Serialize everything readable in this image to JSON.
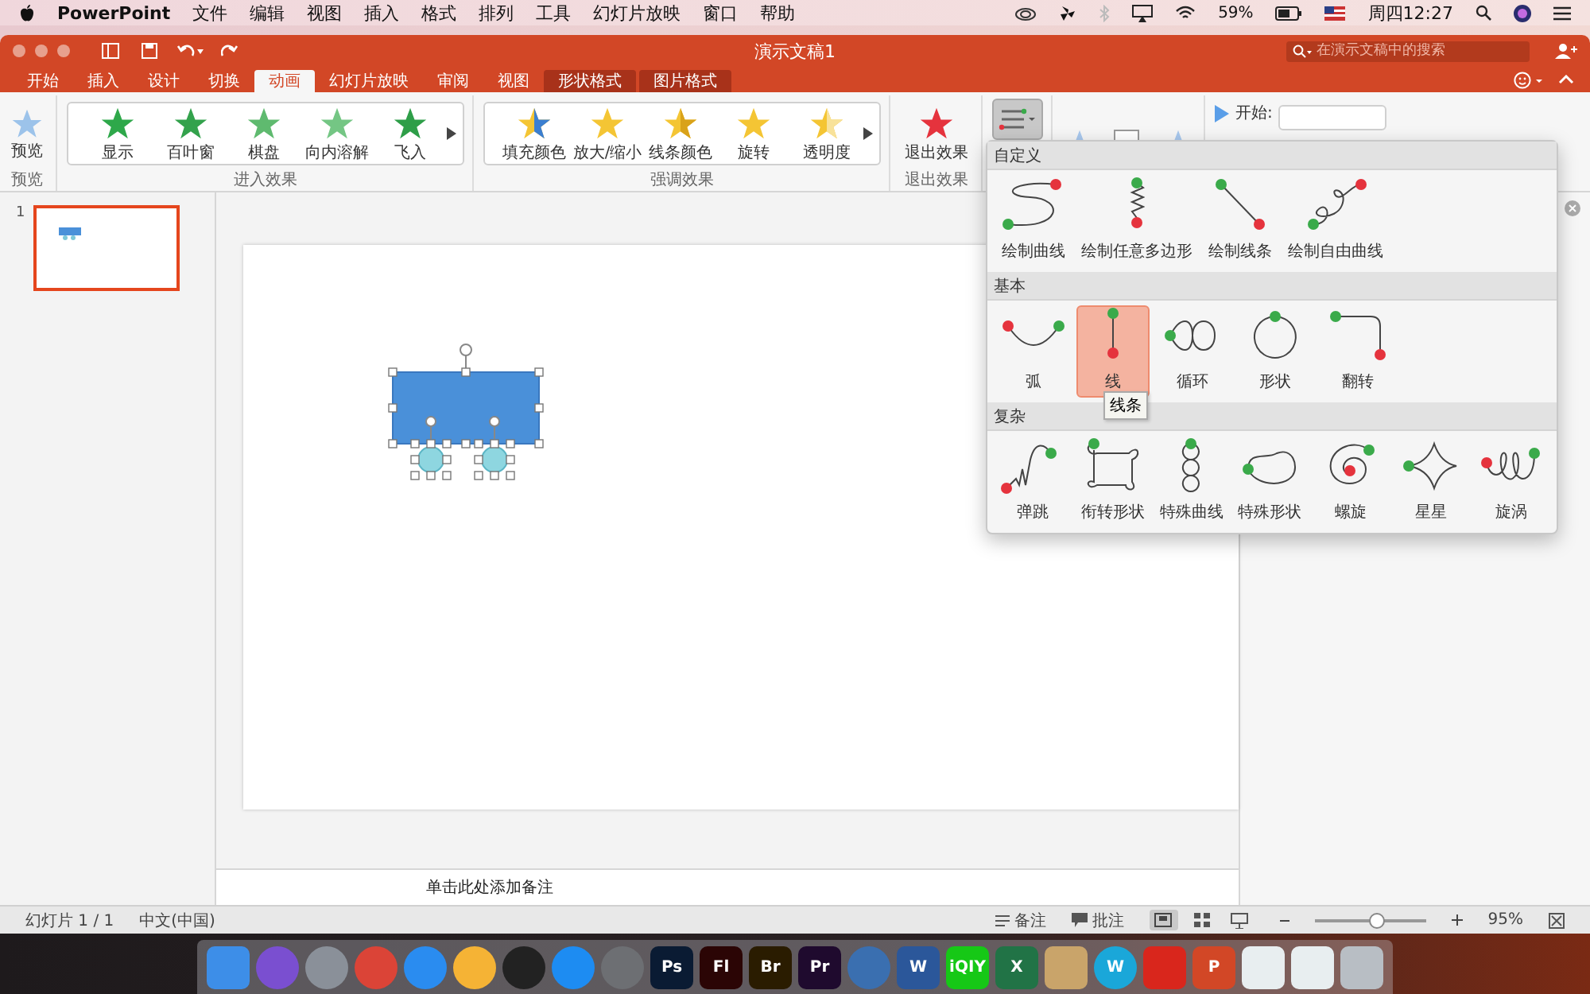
{
  "menu_bar": {
    "app": "PowerPoint",
    "items": [
      "文件",
      "编辑",
      "视图",
      "插入",
      "格式",
      "排列",
      "工具",
      "幻灯片放映",
      "窗口",
      "帮助"
    ],
    "battery": "59%",
    "clock": "周四12:27"
  },
  "window": {
    "title": "演示文稿1",
    "search": {
      "placeholder": "在演示文稿中的搜索"
    }
  },
  "tabs": [
    {
      "label": "开始",
      "selected": false,
      "kind": "normal"
    },
    {
      "label": "插入",
      "selected": false,
      "kind": "normal"
    },
    {
      "label": "设计",
      "selected": false,
      "kind": "normal"
    },
    {
      "label": "切换",
      "selected": false,
      "kind": "normal"
    },
    {
      "label": "动画",
      "selected": true,
      "kind": "normal"
    },
    {
      "label": "幻灯片放映",
      "selected": false,
      "kind": "normal"
    },
    {
      "label": "审阅",
      "selected": false,
      "kind": "normal"
    },
    {
      "label": "视图",
      "selected": false,
      "kind": "normal"
    },
    {
      "label": "形状格式",
      "selected": false,
      "kind": "context"
    },
    {
      "label": "图片格式",
      "selected": false,
      "kind": "context"
    }
  ],
  "ribbon": {
    "preview": {
      "button": "预览",
      "group": "预览"
    },
    "entrance": {
      "group": "进入效果",
      "items": [
        "显示",
        "百叶窗",
        "棋盘",
        "向内溶解",
        "飞入"
      ]
    },
    "emphasis": {
      "group": "强调效果",
      "items": [
        "填充颜色",
        "放大/缩小",
        "线条颜色",
        "旋转",
        "透明度"
      ]
    },
    "exit": {
      "button": "退出效果",
      "group": "退出效果"
    },
    "motion_paths": {
      "pressed": true
    },
    "timing": {
      "start_label": "开始:"
    }
  },
  "slides": [
    {
      "number": "1",
      "selected": true
    }
  ],
  "notes": {
    "placeholder": "单击此处添加备注"
  },
  "status_bar": {
    "slide": "幻灯片 1 / 1",
    "language": "中文(中国)",
    "notes": "备注",
    "comments": "批注",
    "views": [
      {
        "kind": "normal",
        "selected": true
      },
      {
        "kind": "sorter",
        "selected": false
      },
      {
        "kind": "presenter",
        "selected": false
      }
    ],
    "zoom": {
      "level": 0.55,
      "reading": "95%"
    }
  },
  "motion_path_menu": {
    "sections": [
      {
        "title": "自定义",
        "items": [
          {
            "label": "绘制曲线",
            "kind": "curve",
            "selected": false
          },
          {
            "label": "绘制任意多边形",
            "kind": "zigzag",
            "selected": false
          },
          {
            "label": "绘制线条",
            "kind": "line",
            "selected": false
          },
          {
            "label": "绘制自由曲线",
            "kind": "freeform",
            "selected": false
          }
        ]
      },
      {
        "title": "基本",
        "items": [
          {
            "label": "弧",
            "kind": "arc",
            "selected": false
          },
          {
            "label": "线",
            "kind": "vline",
            "selected": true
          },
          {
            "label": "循环",
            "kind": "loop",
            "selected": false
          },
          {
            "label": "形状",
            "kind": "circle",
            "selected": false
          },
          {
            "label": "翻转",
            "kind": "turn",
            "selected": false
          }
        ]
      },
      {
        "title": "复杂",
        "items": [
          {
            "label": "弹跳",
            "kind": "bounce",
            "selected": false
          },
          {
            "label": "衔转形状",
            "kind": "square",
            "selected": false
          },
          {
            "label": "特殊曲线",
            "kind": "rings",
            "selected": false
          },
          {
            "label": "特殊形状",
            "kind": "bean",
            "selected": false
          },
          {
            "label": "螺旋",
            "kind": "spiral",
            "selected": false
          },
          {
            "label": "星星",
            "kind": "star",
            "selected": false
          },
          {
            "label": "旋涡",
            "kind": "loops",
            "selected": false
          }
        ]
      }
    ],
    "tooltip": "线条"
  },
  "dock": [
    {
      "color": "#3d8ee8",
      "kind": "square"
    },
    {
      "color": "#7a4fd0",
      "kind": "round"
    },
    {
      "color": "#8a9099",
      "kind": "round"
    },
    {
      "color": "#db4437",
      "kind": "round"
    },
    {
      "color": "#2a8cf0",
      "kind": "round"
    },
    {
      "color": "#f5b335",
      "kind": "round"
    },
    {
      "color": "#222222",
      "kind": "round"
    },
    {
      "color": "#1d8cf2",
      "kind": "round"
    },
    {
      "color": "#6d6f73",
      "kind": "round"
    },
    {
      "color": "#0a1b33",
      "kind": "square",
      "label": "Ps"
    },
    {
      "color": "#2b0505",
      "kind": "square",
      "label": "Fl"
    },
    {
      "color": "#2a1c00",
      "kind": "square",
      "label": "Br"
    },
    {
      "color": "#1f0a2e",
      "kind": "square",
      "label": "Pr"
    },
    {
      "color": "#3a6fb0",
      "kind": "round"
    },
    {
      "color": "#2b579a",
      "kind": "square",
      "label": "W"
    },
    {
      "color": "#16c816",
      "kind": "square",
      "label": "iQIY"
    },
    {
      "color": "#217346",
      "kind": "square",
      "label": "X"
    },
    {
      "color": "#c9a46a",
      "kind": "square"
    },
    {
      "color": "#1aa7d9",
      "kind": "round",
      "label": "W"
    },
    {
      "color": "#d9261c",
      "kind": "square"
    },
    {
      "color": "#d24726",
      "kind": "square",
      "label": "P"
    },
    {
      "color": "#e8eef0",
      "kind": "square"
    },
    {
      "color": "#e8eef0",
      "kind": "square"
    },
    {
      "color": "#b8bec4",
      "kind": "square"
    }
  ]
}
